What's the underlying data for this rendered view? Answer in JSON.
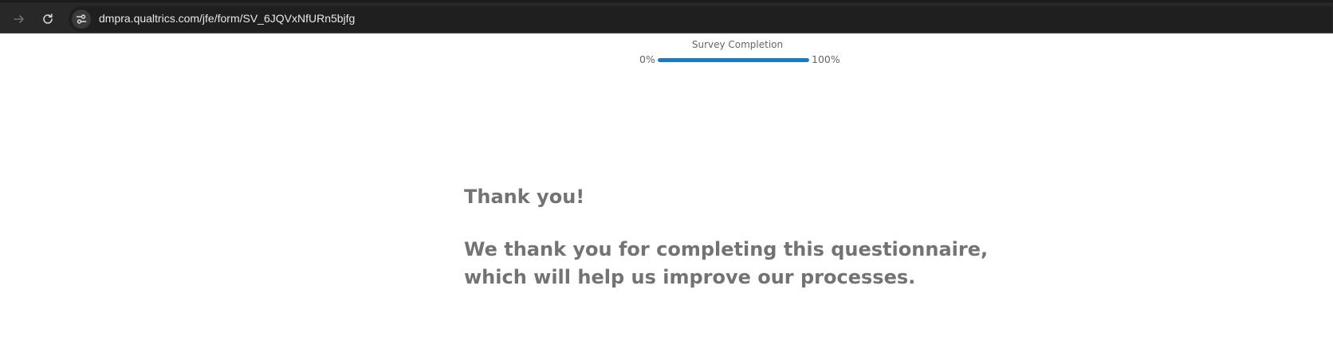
{
  "browser": {
    "url": "dmpra.qualtrics.com/jfe/form/SV_6JQVxNfURn5bjfg"
  },
  "progress": {
    "title": "Survey Completion",
    "min_label": "0%",
    "max_label": "100%",
    "value_percent": 100,
    "fill_color": "#1a7bc4"
  },
  "message": {
    "heading": "Thank you!",
    "body": "We thank you for completing this questionnaire, which will help us improve our processes.",
    "text_color": "#737373"
  }
}
